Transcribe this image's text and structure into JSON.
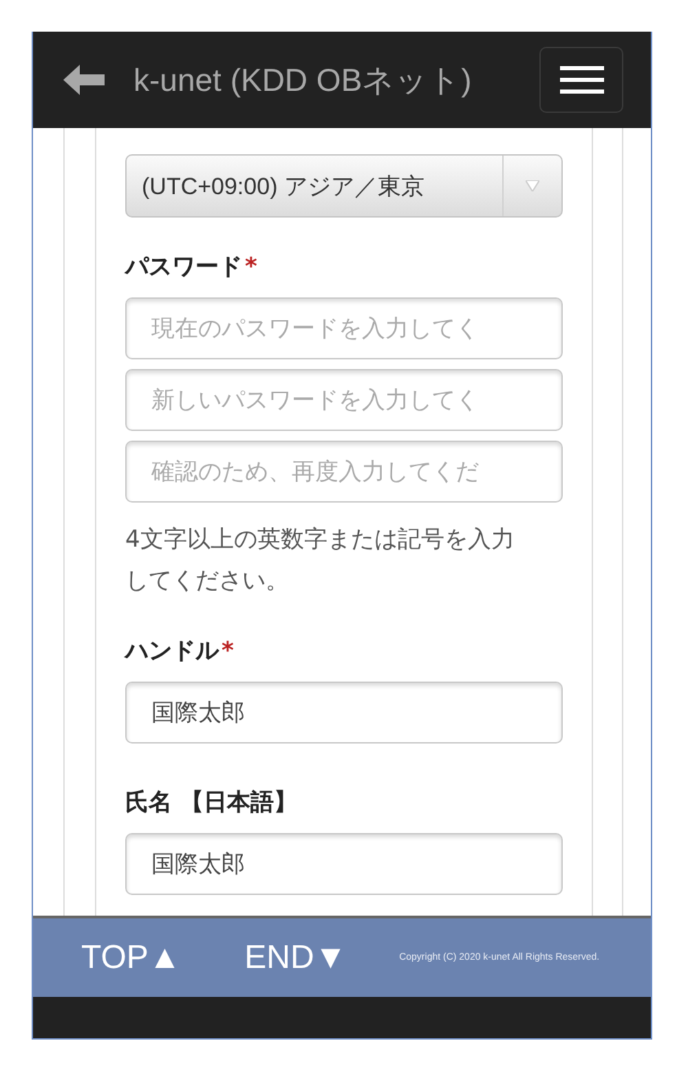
{
  "header": {
    "title": "k-unet (KDD OBネット)"
  },
  "timezone": {
    "value": "(UTC+09:00) アジア／東京"
  },
  "sections": [
    {
      "label": "パスワード",
      "required_mark": "*",
      "fields": [
        {
          "placeholder": "現在のパスワードを入力してく"
        },
        {
          "placeholder": "新しいパスワードを入力してく"
        },
        {
          "placeholder": "確認のため、再度入力してくだ"
        }
      ],
      "help": "4文字以上の英数字または記号を入力してください。"
    },
    {
      "label": "ハンドル",
      "required_mark": "*",
      "fields": [
        {
          "value": "国際太郎"
        }
      ]
    },
    {
      "label": "氏名 【日本語】",
      "fields": [
        {
          "value": "国際太郎"
        }
      ]
    }
  ],
  "footer": {
    "links": [
      "TOP▲",
      "END▼"
    ],
    "copyright": "Copyright (C) 2020 k-unet All Rights Reserved."
  }
}
